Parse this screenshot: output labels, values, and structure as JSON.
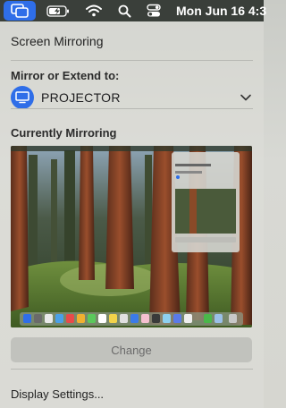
{
  "menubar": {
    "clock": "Mon Jun 16  4:3",
    "icons": [
      "screen-mirroring-icon",
      "battery-charging-icon",
      "wifi-icon",
      "spotlight-search-icon",
      "control-center-icon"
    ]
  },
  "panel": {
    "title": "Screen Mirroring",
    "mirror_label": "Mirror or Extend to:",
    "device": {
      "name": "PROJECTOR",
      "icon": "display-icon"
    },
    "current_label": "Currently Mirroring",
    "change_label": "Change",
    "display_settings_label": "Display Settings..."
  },
  "colors": {
    "accent": "#2f6ee8",
    "menubar": "#3a3f3a",
    "button_bg": "#c1c2bd"
  }
}
